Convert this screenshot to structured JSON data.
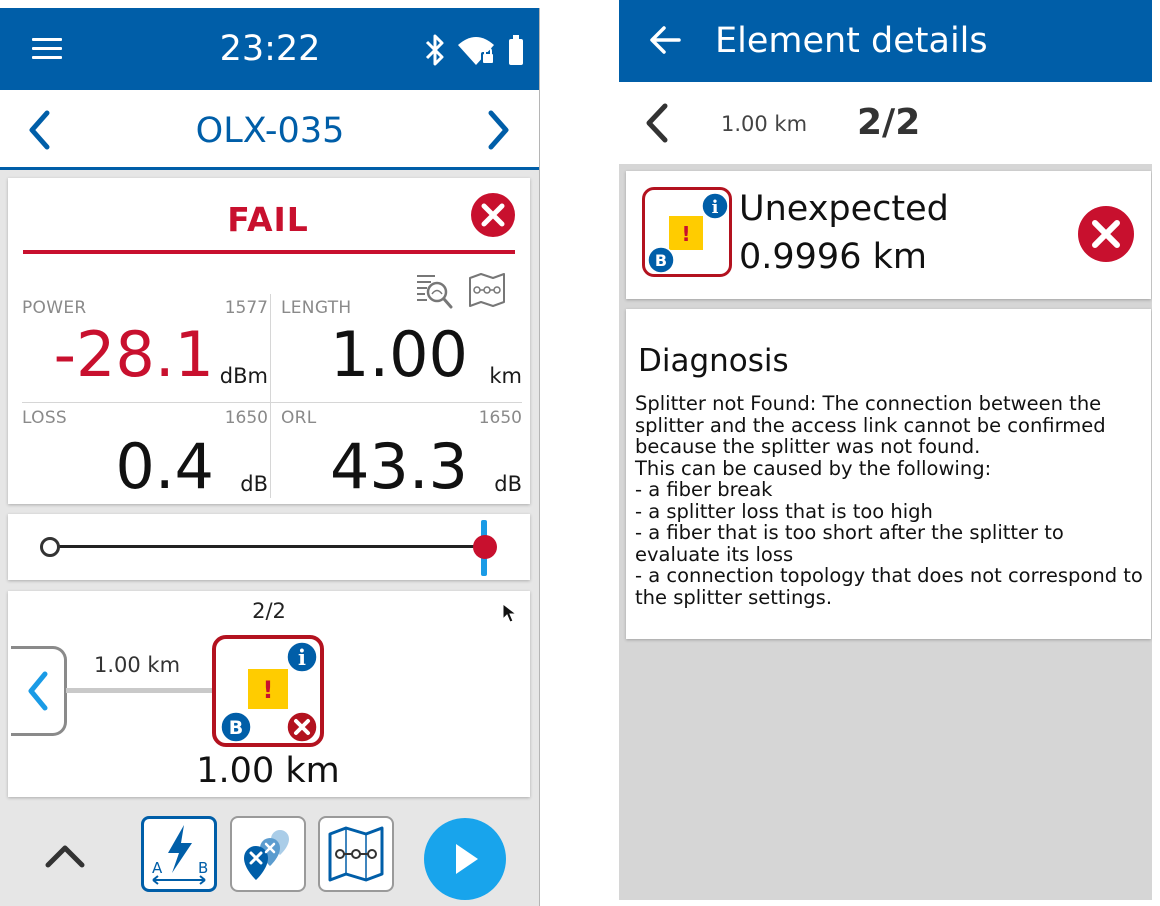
{
  "left_screen": {
    "status_bar": {
      "time": "23:22",
      "icons": [
        "menu-icon",
        "bluetooth-icon",
        "wifi-locked-icon",
        "battery-icon"
      ]
    },
    "nav": {
      "device_name": "OLX-035",
      "prev_icon": "chevron-left-icon",
      "next_icon": "chevron-right-icon"
    },
    "verdict": {
      "status": "FAIL",
      "status_color": "#c8102e",
      "status_icon": "fail-circle-x-icon",
      "tools": [
        "zoom-trace-icon",
        "link-map-icon"
      ]
    },
    "metrics": {
      "power": {
        "label": "POWER",
        "wavelength": "1577",
        "value": "-28.1",
        "unit": "dBm",
        "color": "#c8102e"
      },
      "length": {
        "label": "LENGTH",
        "value": "1.00",
        "unit": "km"
      },
      "loss": {
        "label": "LOSS",
        "wavelength": "1650",
        "value": "0.4",
        "unit": "dB"
      },
      "orl": {
        "label": "ORL",
        "wavelength": "1650",
        "value": "43.3",
        "unit": "dB"
      }
    },
    "slider": {
      "position": 1.0,
      "cursor_color": "#1a9be6",
      "marker_color": "#c8102e"
    },
    "element": {
      "count": "2/2",
      "link_distance": "1.00 km",
      "element_distance": "1.00 km",
      "badges": {
        "info": "i",
        "port": "B",
        "fail": "×",
        "warning": "!"
      }
    },
    "bottom_bar": {
      "expand_icon": "chevron-up-icon",
      "tabs": [
        {
          "name": "ab-test",
          "label_a": "A",
          "label_b": "B",
          "active": true
        },
        {
          "name": "pins",
          "active": false
        },
        {
          "name": "link-map",
          "active": false
        }
      ],
      "play_icon": "play-icon",
      "play_color": "#18a4ec"
    }
  },
  "right_screen": {
    "header": {
      "title": "Element details",
      "back_icon": "back-arrow-icon"
    },
    "nav": {
      "distance": "1.00 km",
      "count": "2/2",
      "prev_icon": "chevron-left-icon"
    },
    "summary": {
      "type": "Unexpected",
      "distance": "0.9996 km",
      "badges": {
        "info": "i",
        "port": "B",
        "warning": "!"
      },
      "status_icon": "fail-circle-x-icon"
    },
    "diagnosis": {
      "title": "Diagnosis",
      "text": "Splitter not Found: The connection between the splitter and the access link cannot be confirmed because the splitter was not found.\nThis can be caused by the following:\n- a fiber break\n- a splitter loss that is too high\n- a fiber that is too short after the splitter to evaluate its loss\n- a connection topology that does not correspond to the splitter settings."
    }
  },
  "colors": {
    "brand_blue": "#005ea8",
    "fail_red": "#c8102e",
    "accent_blue": "#18a4ec"
  }
}
